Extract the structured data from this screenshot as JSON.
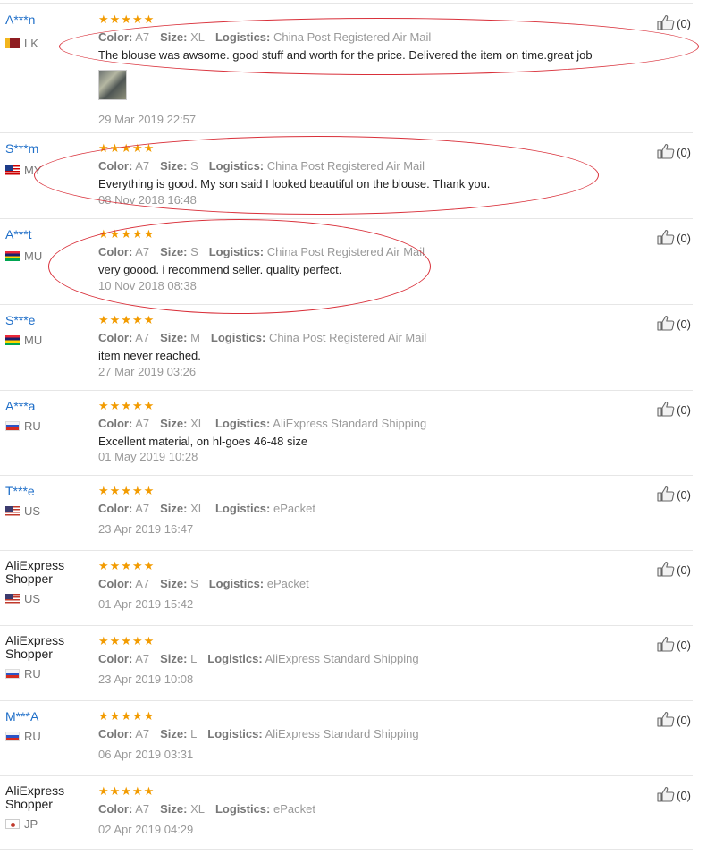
{
  "labels": {
    "color": "Color:",
    "size": "Size:",
    "logistics": "Logistics:"
  },
  "colors": {
    "star": "#f29b00",
    "name_link": "#1e6ec8",
    "annotation": "#d9303a"
  },
  "reviews": [
    {
      "name": "A***n",
      "country": "LK",
      "stars": 5,
      "color": "A7",
      "size": "XL",
      "logistics": "China Post Registered Air Mail",
      "text": "The blouse was awsome. good stuff and worth for the price. Delivered the item on time.great job",
      "date": "29 Mar 2019 22:57",
      "helpful": "(0)",
      "has_photo": true
    },
    {
      "name": "S***m",
      "country": "MY",
      "stars": 5,
      "color": "A7",
      "size": "S",
      "logistics": "China Post Registered Air Mail",
      "text": "Everything is good. My son said I looked beautiful on the blouse. Thank you.",
      "date": "08 Nov 2018 16:48",
      "helpful": "(0)"
    },
    {
      "name": "A***t",
      "country": "MU",
      "stars": 5,
      "color": "A7",
      "size": "S",
      "logistics": "China Post Registered Air Mail",
      "text": "very goood. i recommend seller. quality perfect.",
      "date": "10 Nov 2018 08:38",
      "helpful": "(0)"
    },
    {
      "name": "S***e",
      "country": "MU",
      "stars": 5,
      "color": "A7",
      "size": "M",
      "logistics": "China Post Registered Air Mail",
      "text": "item never reached.",
      "date": "27 Mar 2019 03:26",
      "helpful": "(0)"
    },
    {
      "name": "A***a",
      "country": "RU",
      "stars": 5,
      "color": "A7",
      "size": "XL",
      "logistics": "AliExpress Standard Shipping",
      "text": "Excellent material, on hl-goes 46-48 size",
      "date": "01 May 2019 10:28",
      "helpful": "(0)"
    },
    {
      "name": "T***e",
      "country": "US",
      "stars": 5,
      "color": "A7",
      "size": "XL",
      "logistics": "ePacket",
      "text": "",
      "date": "23 Apr 2019 16:47",
      "helpful": "(0)"
    },
    {
      "name": "AliExpress Shopper",
      "country": "US",
      "stars": 5,
      "color": "A7",
      "size": "S",
      "logistics": "ePacket",
      "text": "",
      "date": "01 Apr 2019 15:42",
      "helpful": "(0)"
    },
    {
      "name": "AliExpress Shopper",
      "country": "RU",
      "stars": 5,
      "color": "A7",
      "size": "L",
      "logistics": "AliExpress Standard Shipping",
      "text": "",
      "date": "23 Apr 2019 10:08",
      "helpful": "(0)"
    },
    {
      "name": "M***A",
      "country": "RU",
      "stars": 5,
      "color": "A7",
      "size": "L",
      "logistics": "AliExpress Standard Shipping",
      "text": "",
      "date": "06 Apr 2019 03:31",
      "helpful": "(0)"
    },
    {
      "name": "AliExpress Shopper",
      "country": "JP",
      "stars": 5,
      "color": "A7",
      "size": "XL",
      "logistics": "ePacket",
      "text": "",
      "date": "02 Apr 2019 04:29",
      "helpful": "(0)"
    }
  ]
}
